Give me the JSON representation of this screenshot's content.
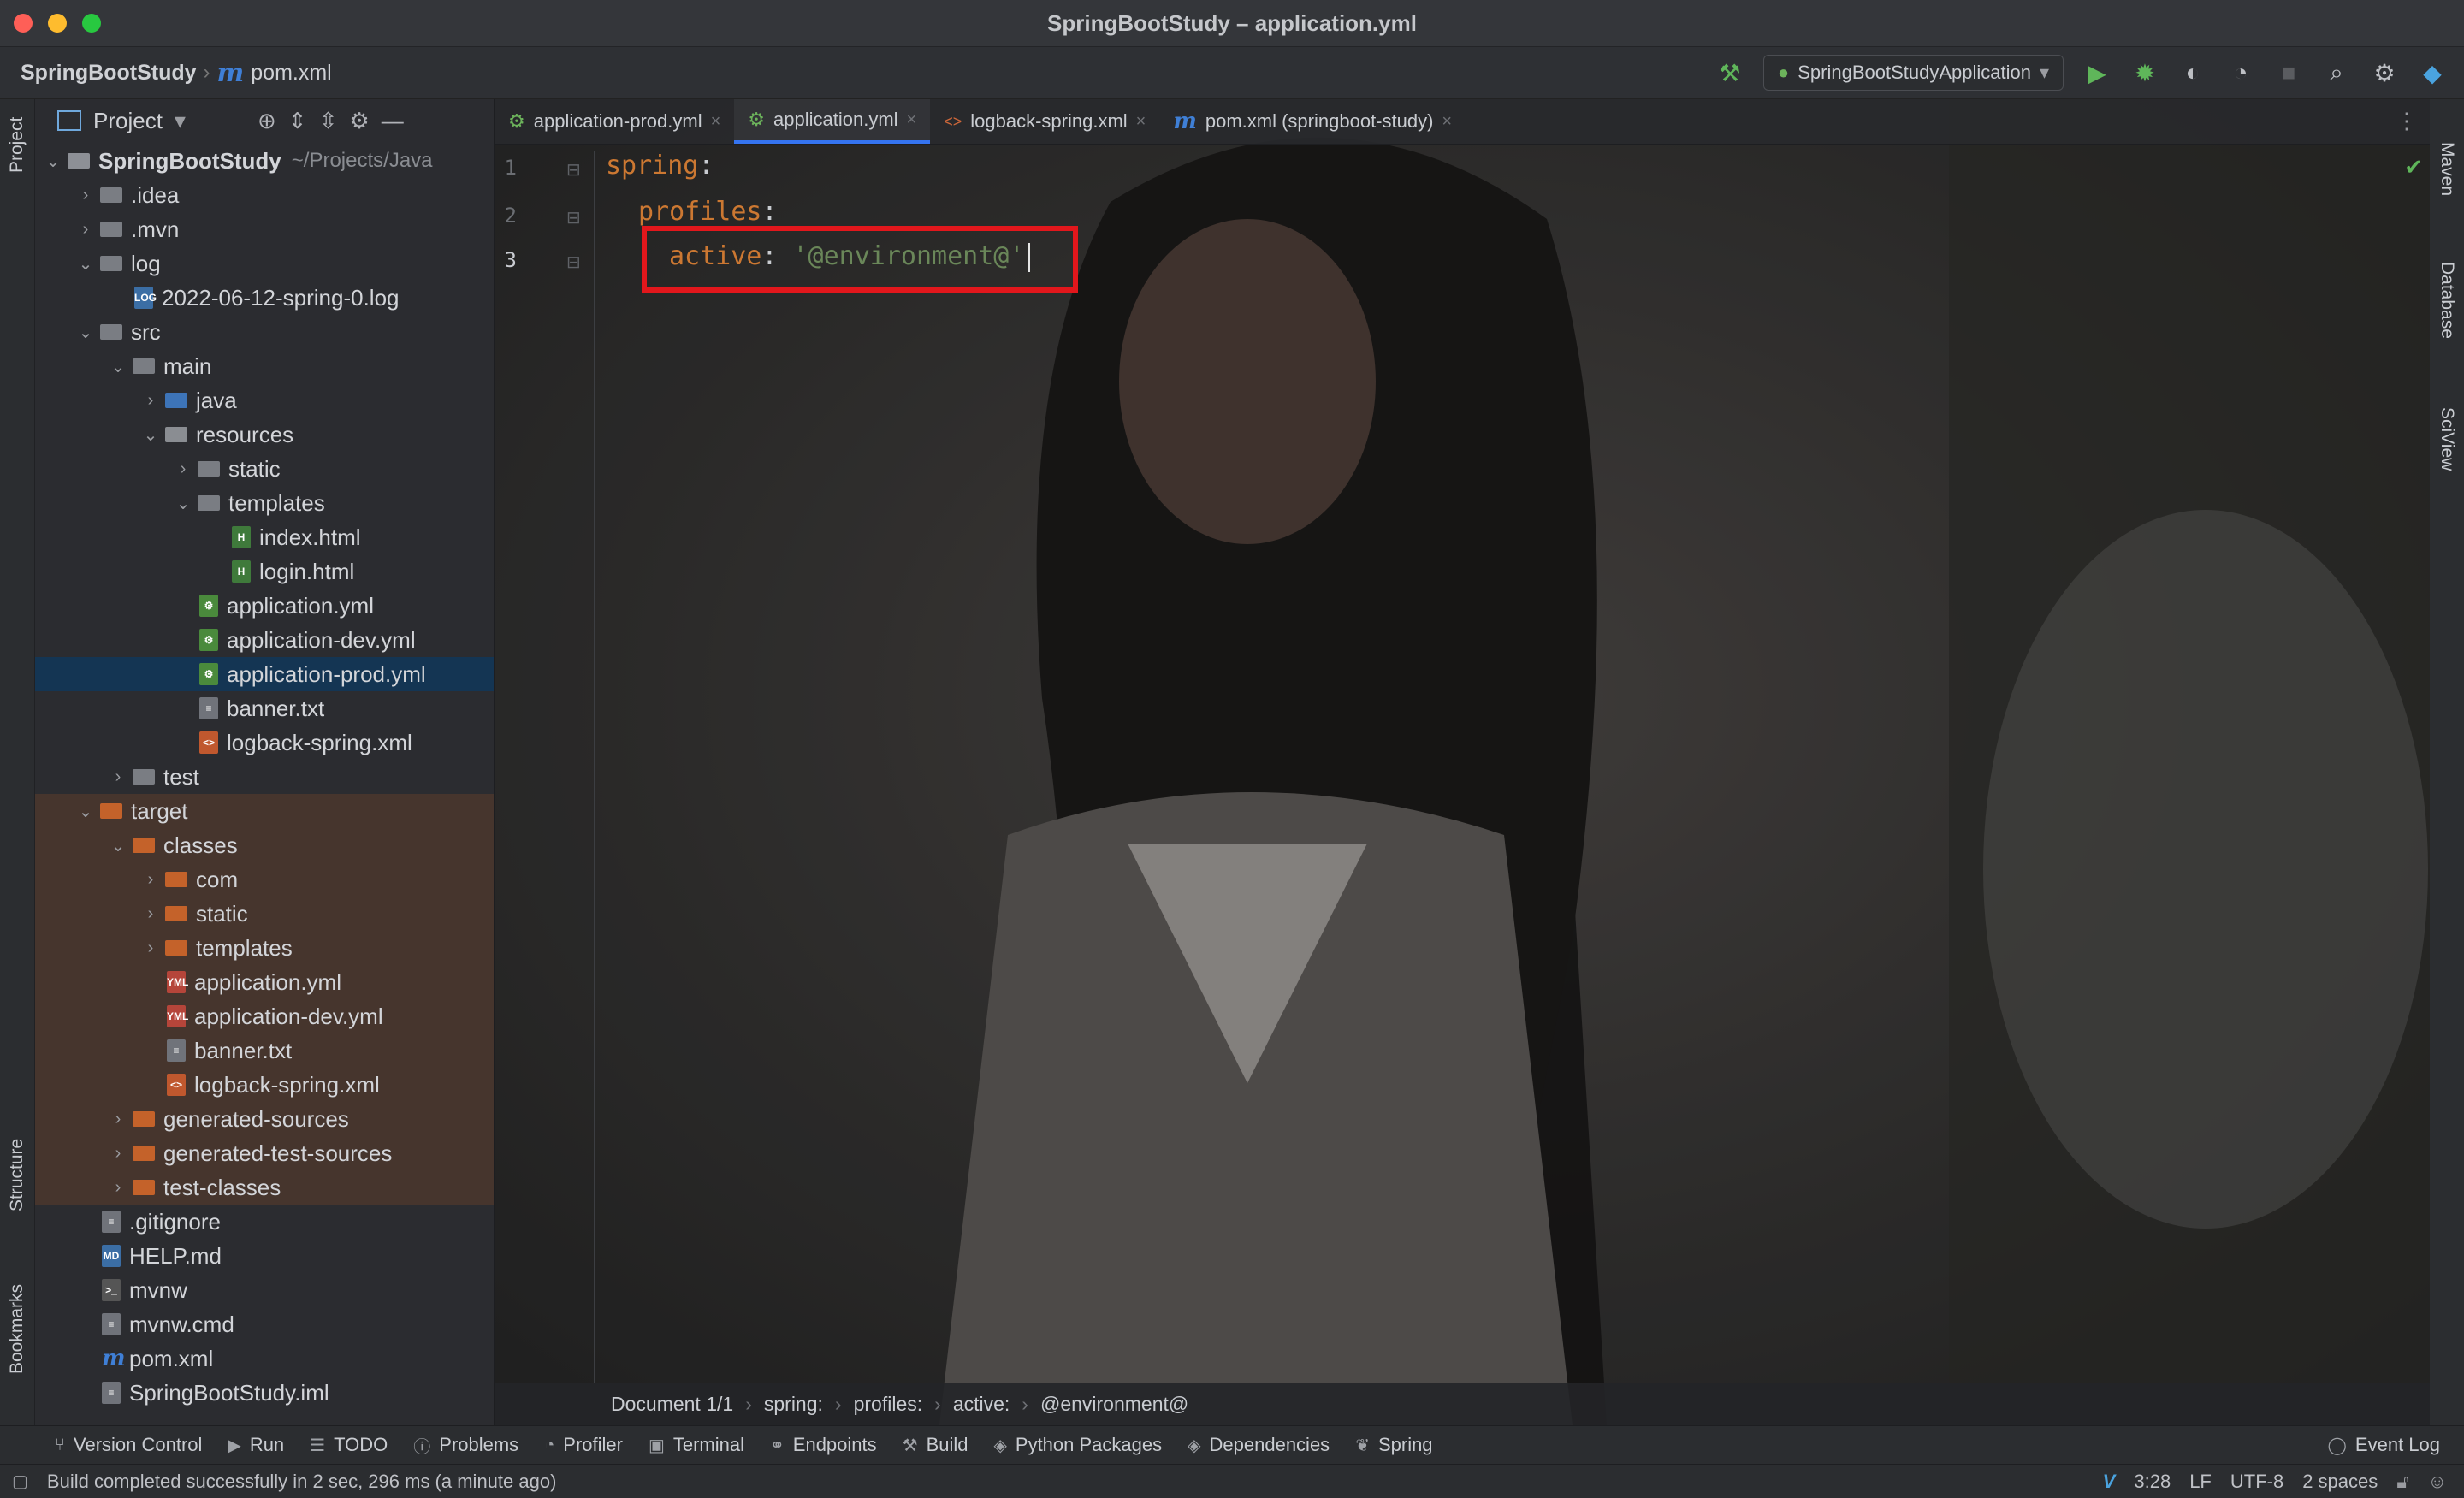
{
  "window": {
    "title": "SpringBootStudy – application.yml"
  },
  "navbar": {
    "project": "SpringBootStudy",
    "file": "pom.xml",
    "run_config": "SpringBootStudyApplication"
  },
  "left_strip": {
    "project": "Project",
    "structure": "Structure",
    "bookmarks": "Bookmarks"
  },
  "right_strip": {
    "maven": "Maven",
    "database": "Database",
    "sciview": "SciView"
  },
  "project_panel": {
    "title": "Project",
    "tree": [
      {
        "label": "SpringBootStudy",
        "hint": "~/Projects/Java",
        "depth": 0,
        "kind": "project",
        "open": true
      },
      {
        "label": ".idea",
        "depth": 1,
        "kind": "folder",
        "open": false
      },
      {
        "label": ".mvn",
        "depth": 1,
        "kind": "folder",
        "open": false
      },
      {
        "label": "log",
        "depth": 1,
        "kind": "folder",
        "open": true
      },
      {
        "label": "2022-06-12-spring-0.log",
        "depth": 2,
        "kind": "log"
      },
      {
        "label": "src",
        "depth": 1,
        "kind": "folder",
        "open": true
      },
      {
        "label": "main",
        "depth": 2,
        "kind": "folder",
        "open": true
      },
      {
        "label": "java",
        "depth": 3,
        "kind": "src",
        "open": false
      },
      {
        "label": "resources",
        "depth": 3,
        "kind": "res",
        "open": true
      },
      {
        "label": "static",
        "depth": 4,
        "kind": "folder",
        "open": false
      },
      {
        "label": "templates",
        "depth": 4,
        "kind": "folder",
        "open": true
      },
      {
        "label": "index.html",
        "depth": 5,
        "kind": "html"
      },
      {
        "label": "login.html",
        "depth": 5,
        "kind": "html"
      },
      {
        "label": "application.yml",
        "depth": 4,
        "kind": "yml"
      },
      {
        "label": "application-dev.yml",
        "depth": 4,
        "kind": "yml"
      },
      {
        "label": "application-prod.yml",
        "depth": 4,
        "kind": "yml",
        "selected": true
      },
      {
        "label": "banner.txt",
        "depth": 4,
        "kind": "txt"
      },
      {
        "label": "logback-spring.xml",
        "depth": 4,
        "kind": "xml"
      },
      {
        "label": "test",
        "depth": 2,
        "kind": "folder",
        "open": false
      },
      {
        "label": "target",
        "depth": 1,
        "kind": "org",
        "open": true,
        "target": true
      },
      {
        "label": "classes",
        "depth": 2,
        "kind": "org",
        "open": true,
        "target": true
      },
      {
        "label": "com",
        "depth": 3,
        "kind": "org",
        "open": false,
        "target": true
      },
      {
        "label": "static",
        "depth": 3,
        "kind": "org",
        "open": false,
        "target": true
      },
      {
        "label": "templates",
        "depth": 3,
        "kind": "org",
        "open": false,
        "target": true
      },
      {
        "label": "application.yml",
        "depth": 3,
        "kind": "ymlr",
        "target": true
      },
      {
        "label": "application-dev.yml",
        "depth": 3,
        "kind": "ymlr",
        "target": true
      },
      {
        "label": "banner.txt",
        "depth": 3,
        "kind": "txt",
        "target": true
      },
      {
        "label": "logback-spring.xml",
        "depth": 3,
        "kind": "xml",
        "target": true
      },
      {
        "label": "generated-sources",
        "depth": 2,
        "kind": "org",
        "open": false,
        "target": true
      },
      {
        "label": "generated-test-sources",
        "depth": 2,
        "kind": "org",
        "open": false,
        "target": true
      },
      {
        "label": "test-classes",
        "depth": 2,
        "kind": "org",
        "open": false,
        "target": true
      },
      {
        "label": ".gitignore",
        "depth": 1,
        "kind": "txt"
      },
      {
        "label": "HELP.md",
        "depth": 1,
        "kind": "md"
      },
      {
        "label": "mvnw",
        "depth": 1,
        "kind": "sh"
      },
      {
        "label": "mvnw.cmd",
        "depth": 1,
        "kind": "txt"
      },
      {
        "label": "pom.xml",
        "depth": 1,
        "kind": "pom"
      },
      {
        "label": "SpringBootStudy.iml",
        "depth": 1,
        "kind": "txt"
      }
    ]
  },
  "tabs": [
    {
      "label": "application-prod.yml",
      "icon": "spring-yml-icon"
    },
    {
      "label": "application.yml",
      "icon": "spring-yml-icon",
      "active": true
    },
    {
      "label": "logback-spring.xml",
      "icon": "xml-icon"
    },
    {
      "label": "pom.xml (springboot-study)",
      "icon": "maven-icon"
    }
  ],
  "editor": {
    "line_numbers": [
      "1",
      "2",
      "3"
    ],
    "line1": {
      "key": "spring",
      "colon": ":"
    },
    "line2": {
      "key": "profiles",
      "colon": ":"
    },
    "line3": {
      "key": "active",
      "colon": ": ",
      "value": "'@environment@'"
    }
  },
  "breadcrumb": {
    "items": [
      "Document 1/1",
      "spring:",
      "profiles:",
      "active:",
      "@environment@"
    ]
  },
  "toolwindows": [
    "Version Control",
    "Run",
    "TODO",
    "Problems",
    "Profiler",
    "Terminal",
    "Endpoints",
    "Build",
    "Python Packages",
    "Dependencies",
    "Spring"
  ],
  "event_log": "Event Log",
  "status": {
    "message": "Build completed successfully in 2 sec, 296 ms (a minute ago)",
    "position": "3:28",
    "line_sep": "LF",
    "encoding": "UTF-8",
    "indent": "2 spaces"
  },
  "colors": {
    "accent": "#3574f0",
    "highlight_box": "#e2171c",
    "yaml_key": "#cc7832",
    "yaml_string": "#6a8759"
  }
}
